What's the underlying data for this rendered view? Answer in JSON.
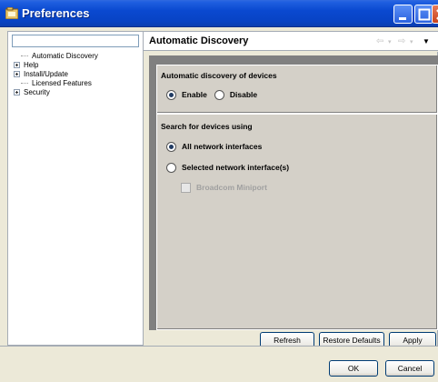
{
  "window": {
    "title": "Preferences"
  },
  "filter": {
    "value": "",
    "placeholder": ""
  },
  "tree": [
    {
      "label": "Automatic Discovery",
      "expandable": false,
      "selected": true
    },
    {
      "label": "Help",
      "expandable": true
    },
    {
      "label": "Install/Update",
      "expandable": true
    },
    {
      "label": "Licensed Features",
      "expandable": false
    },
    {
      "label": "Security",
      "expandable": true
    }
  ],
  "page": {
    "title": "Automatic Discovery",
    "discovery_group": {
      "title": "Automatic discovery of devices",
      "enable_label": "Enable",
      "disable_label": "Disable"
    },
    "search_group": {
      "title": "Search for devices using",
      "all_label": "All network interfaces",
      "selected_label": "Selected network interface(s)",
      "broadcom_label": "Broadcom Miniport"
    }
  },
  "buttons": {
    "refresh": "Refresh",
    "restore_defaults": "Restore Defaults",
    "apply": "Apply",
    "ok": "OK",
    "cancel": "Cancel"
  },
  "colors": {
    "titlebar": "#0a49d0",
    "dialog_bg": "#ece9d8",
    "group_bg": "#d4d0c8",
    "content_bg": "#808080"
  }
}
